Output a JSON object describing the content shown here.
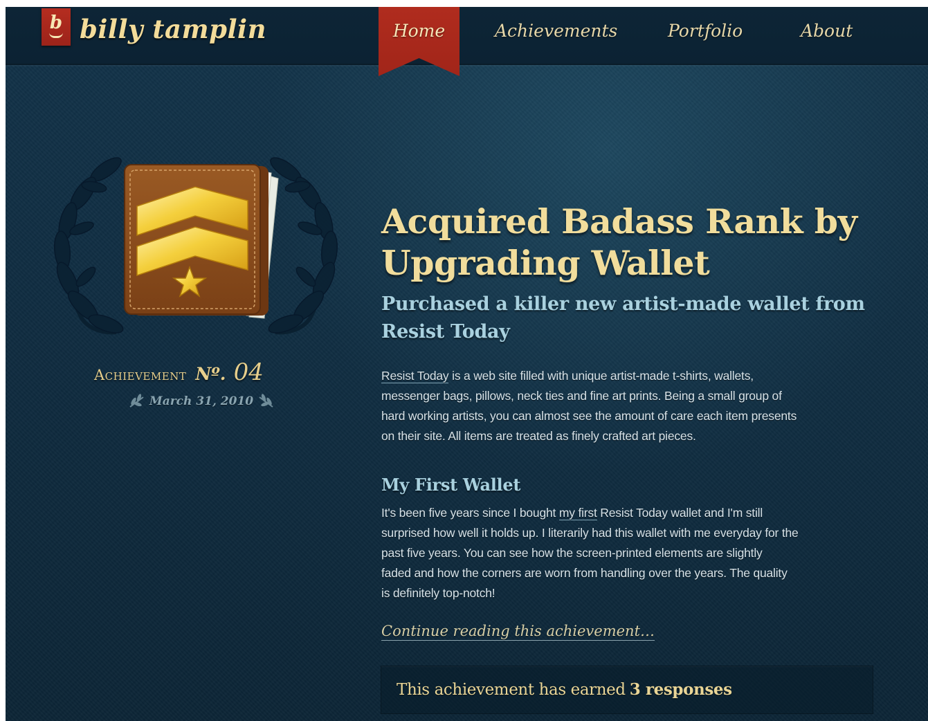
{
  "header": {
    "logo_letter": "b",
    "site_name": "billy tamplin",
    "nav": {
      "home": "Home",
      "achievements": "Achievements",
      "portfolio": "Portfolio",
      "about": "About"
    },
    "active_nav": "Home"
  },
  "achievement": {
    "label": "Achievement",
    "number_prefix": "Nº.",
    "number": "04",
    "date": "March 31, 2010"
  },
  "article": {
    "title_line1": "Acquired Badass Rank by",
    "title_line2": "Upgrading Wallet",
    "subtitle_line1": "Purchased a killer new artist-made wallet from",
    "subtitle_line2": "Resist Today",
    "paragraph1": {
      "link": "Resist Today",
      "line1": " is a web site filled with unique artist-made t-shirts, wallets,",
      "line2": "messenger bags, pillows, neck ties and fine art prints. Being a small group of",
      "line3": "hard working artists, you can almost see the amount of care each item presents",
      "line4": "on their site. All items are treated as finely crafted art pieces."
    },
    "section_heading": "My First Wallet",
    "paragraph2": {
      "line1_before": "It's been five years since I bought ",
      "line1_link": "my first",
      "line1_after": " Resist Today wallet and I'm still",
      "line2": "surprised how well it holds up. I literarily had this wallet with me everyday for the",
      "line3": "past five years. You can see how the screen-printed elements are slightly",
      "line4": "faded and how the corners are worn from handling over the years. The quality",
      "line5": "is definitely top-notch!"
    },
    "continue_link": "Continue reading this achievement…",
    "responses_text": "This achievement has earned",
    "responses_count": "3 responses"
  },
  "icons": [
    "wallet-rank-icon",
    "laurel-wreath-icon",
    "sprig-icon"
  ],
  "colors": {
    "background": "#0f2c40",
    "header_bg": "#0c2233",
    "accent_red": "#a8281c",
    "title_gold": "#f1dd9c",
    "subtitle_blue": "#a9d1df",
    "body_text": "#d6e2e8"
  }
}
